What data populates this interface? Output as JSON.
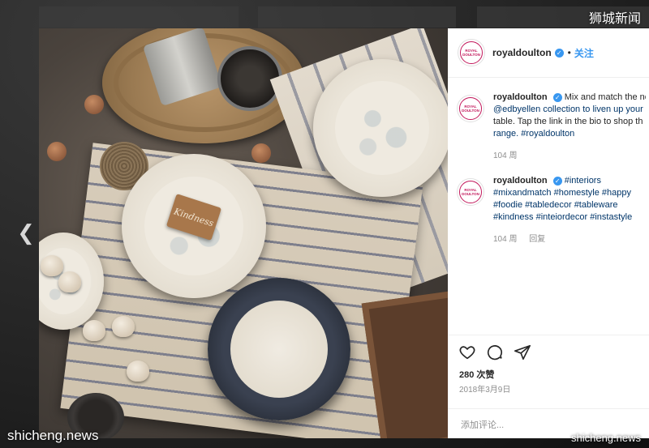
{
  "watermarks": {
    "top_right": "狮城新闻",
    "bottom_left": "shicheng.news",
    "bottom_right": "shicheng.news"
  },
  "photo": {
    "tag_text": "Kindness",
    "prev_icon": "chevron-left-icon"
  },
  "account": {
    "avatar_text": "ROYAL DOULTON",
    "username": "royaldoulton",
    "verified_icon": "verified-badge-icon",
    "separator": "•",
    "follow_label": "关注",
    "brand_color": "#c2185b",
    "link_color": "#3897f0"
  },
  "comments": [
    {
      "username": "royaldoulton",
      "lines": [
        "Mix and match the ne",
        "@edbyellen collection to liven up your",
        "table. Tap the link in the bio to shop th",
        "range. #royaldoulton"
      ],
      "likes": "104 周",
      "reply": ""
    },
    {
      "username": "royaldoulton",
      "lines": [
        "#interiors",
        "#mixandmatch #homestyle #happy",
        "#foodie #tabledecor #tableware",
        "#kindness #inteiordecor #instastyle"
      ],
      "likes": "104 周",
      "reply": "回复"
    }
  ],
  "actions": {
    "icons": [
      "heart-icon",
      "comment-icon",
      "share-icon"
    ],
    "likes": "280 次赞",
    "date": "2018年3月9日",
    "comment_placeholder": "添加评论..."
  }
}
